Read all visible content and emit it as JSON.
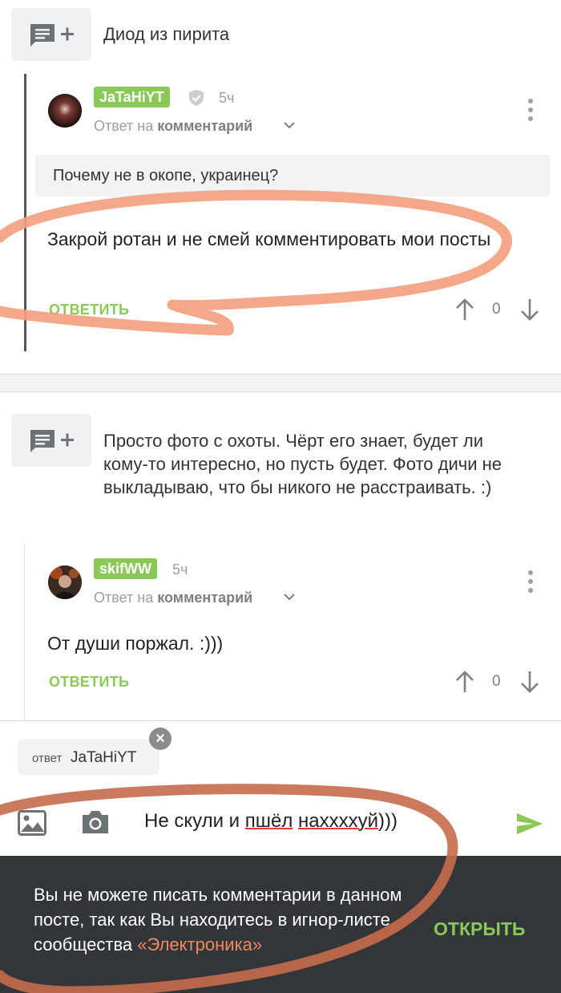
{
  "post1": {
    "title": "Диод из пирита"
  },
  "comment1": {
    "nick": "JaTaHiYT",
    "time": "5ч",
    "reply_prefix": "Ответ на",
    "reply_target": "комментарий",
    "quote": "Почему не в окопе, украинец?",
    "text": "Закрой ротан и не смей комментировать мои посты",
    "reply_label": "ОТВЕТИТЬ",
    "score": "0"
  },
  "post2": {
    "title": "Просто фото с охоты. Чёрт его знает, будет ли кому-то интересно, но пусть будет. Фото дичи не выкладываю, что бы никого не расстраивать. :)"
  },
  "comment2": {
    "nick": "skifWW",
    "time": "5ч",
    "reply_prefix": "Ответ на",
    "reply_target": "комментарий",
    "text": "От души поржал. :)))",
    "reply_label": "ОТВЕТИТЬ",
    "score": "0"
  },
  "composer": {
    "reply_chip_prefix": "ответ",
    "reply_chip_name": "JaTaHiYT",
    "input_plain": "Не скули и ",
    "input_word1": "пшёл",
    "input_space": " ",
    "input_word2": "наххххуй",
    "input_tail": ")))"
  },
  "snackbar": {
    "text_main": "Вы не можете писать комментарии в данном посте, так как Вы находитесь в игнор-листе сообщества ",
    "text_community": "«Электроника»",
    "action": "ОТКРЫТЬ"
  },
  "colors": {
    "accent_green": "#8ac858",
    "snackbar_bg": "#323638",
    "annotation_orange": "#f4a07f"
  },
  "icons": [
    "comment-add-icon",
    "shield-icon",
    "chevron-down-icon",
    "kebab-menu-icon",
    "arrow-up-icon",
    "arrow-down-icon",
    "close-icon",
    "image-icon",
    "camera-icon",
    "send-icon"
  ]
}
